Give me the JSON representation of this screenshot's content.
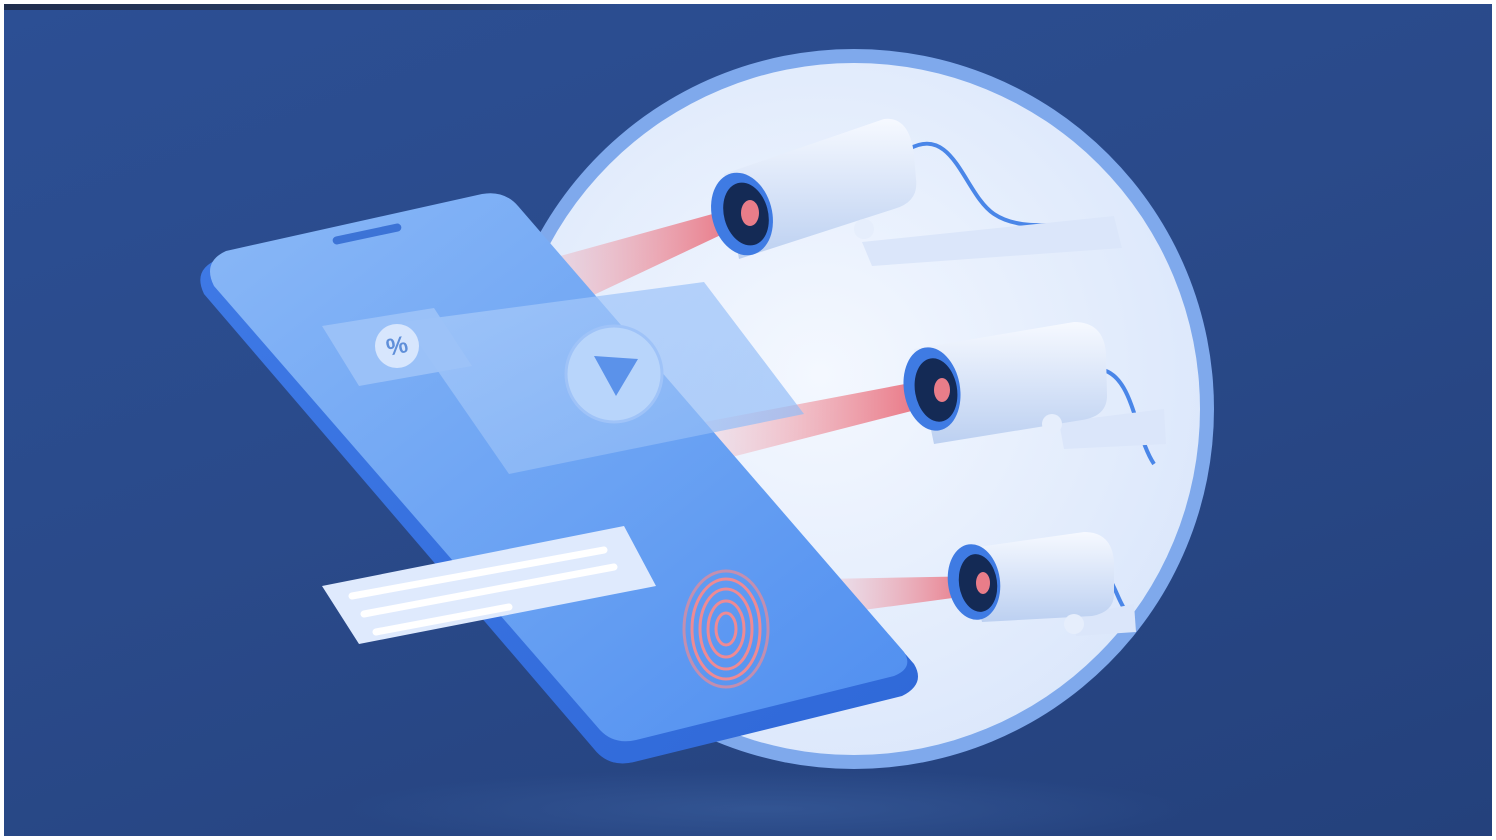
{
  "illustration": {
    "subject": "smartphone-under-camera-surveillance",
    "icons": [
      "percent-icon",
      "play-icon",
      "fingerprint-icon",
      "security-camera-icon",
      "security-camera-icon",
      "security-camera-icon"
    ],
    "colors": {
      "background": "#2a4a8a",
      "circle_fill": "#eaf1fd",
      "circle_ring": "#8fb5f0",
      "phone_body": "#4d8cf0",
      "phone_screen": "#7fb0f5",
      "laser": "#f07b86",
      "camera_body": "#e4ecfb",
      "camera_lens": "#17315f"
    }
  }
}
